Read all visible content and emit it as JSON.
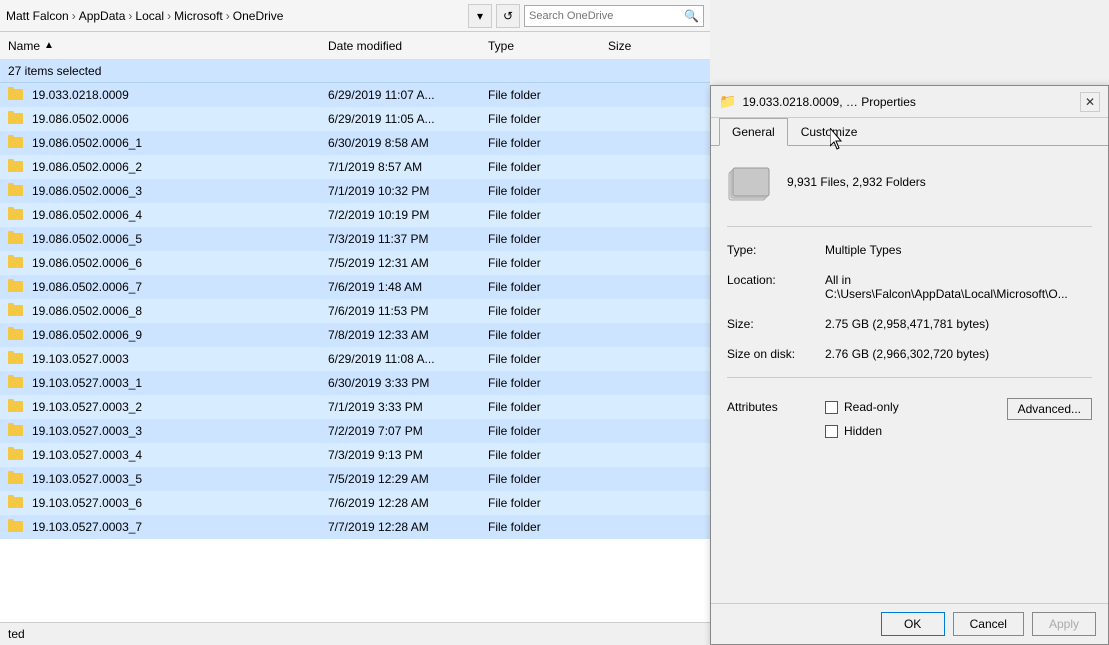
{
  "explorer": {
    "breadcrumb": [
      "Matt Falcon",
      "AppData",
      "Local",
      "Microsoft",
      "OneDrive"
    ],
    "search_placeholder": "Search OneDrive",
    "selected_count": "27 items selected",
    "columns": {
      "name": "Name",
      "date": "Date modified",
      "type": "Type",
      "size": "Size"
    },
    "files": [
      {
        "name": "19.033.0218.0009",
        "date": "6/29/2019 11:07 A...",
        "type": "File folder",
        "size": ""
      },
      {
        "name": "19.086.0502.0006",
        "date": "6/29/2019 11:05 A...",
        "type": "File folder",
        "size": ""
      },
      {
        "name": "19.086.0502.0006_1",
        "date": "6/30/2019 8:58 AM",
        "type": "File folder",
        "size": ""
      },
      {
        "name": "19.086.0502.0006_2",
        "date": "7/1/2019 8:57 AM",
        "type": "File folder",
        "size": ""
      },
      {
        "name": "19.086.0502.0006_3",
        "date": "7/1/2019 10:32 PM",
        "type": "File folder",
        "size": ""
      },
      {
        "name": "19.086.0502.0006_4",
        "date": "7/2/2019 10:19 PM",
        "type": "File folder",
        "size": ""
      },
      {
        "name": "19.086.0502.0006_5",
        "date": "7/3/2019 11:37 PM",
        "type": "File folder",
        "size": ""
      },
      {
        "name": "19.086.0502.0006_6",
        "date": "7/5/2019 12:31 AM",
        "type": "File folder",
        "size": ""
      },
      {
        "name": "19.086.0502.0006_7",
        "date": "7/6/2019 1:48 AM",
        "type": "File folder",
        "size": ""
      },
      {
        "name": "19.086.0502.0006_8",
        "date": "7/6/2019 11:53 PM",
        "type": "File folder",
        "size": ""
      },
      {
        "name": "19.086.0502.0006_9",
        "date": "7/8/2019 12:33 AM",
        "type": "File folder",
        "size": ""
      },
      {
        "name": "19.103.0527.0003",
        "date": "6/29/2019 11:08 A...",
        "type": "File folder",
        "size": ""
      },
      {
        "name": "19.103.0527.0003_1",
        "date": "6/30/2019 3:33 PM",
        "type": "File folder",
        "size": ""
      },
      {
        "name": "19.103.0527.0003_2",
        "date": "7/1/2019 3:33 PM",
        "type": "File folder",
        "size": ""
      },
      {
        "name": "19.103.0527.0003_3",
        "date": "7/2/2019 7:07 PM",
        "type": "File folder",
        "size": ""
      },
      {
        "name": "19.103.0527.0003_4",
        "date": "7/3/2019 9:13 PM",
        "type": "File folder",
        "size": ""
      },
      {
        "name": "19.103.0527.0003_5",
        "date": "7/5/2019 12:29 AM",
        "type": "File folder",
        "size": ""
      },
      {
        "name": "19.103.0527.0003_6",
        "date": "7/6/2019 12:28 AM",
        "type": "File folder",
        "size": ""
      },
      {
        "name": "19.103.0527.0003_7",
        "date": "7/7/2019 12:28 AM",
        "type": "File folder",
        "size": ""
      }
    ],
    "status_text": "ted"
  },
  "properties_dialog": {
    "title": "19.033.0218.0009, … Properties",
    "folder_icon": "📁",
    "tabs": [
      "General",
      "Customize"
    ],
    "active_tab": "General",
    "summary": "9,931 Files, 2,932 Folders",
    "type_label": "Type:",
    "type_value": "Multiple Types",
    "location_label": "Location:",
    "location_value": "All in C:\\Users\\Falcon\\AppData\\Local\\Microsoft\\O...",
    "size_label": "Size:",
    "size_value": "2.75 GB (2,958,471,781 bytes)",
    "size_on_disk_label": "Size on disk:",
    "size_on_disk_value": "2.76 GB (2,966,302,720 bytes)",
    "attributes_label": "Attributes",
    "readonly_label": "Read-only",
    "hidden_label": "Hidden",
    "advanced_btn": "Advanced...",
    "ok_btn": "OK",
    "cancel_btn": "Cancel",
    "apply_btn": "Apply"
  }
}
